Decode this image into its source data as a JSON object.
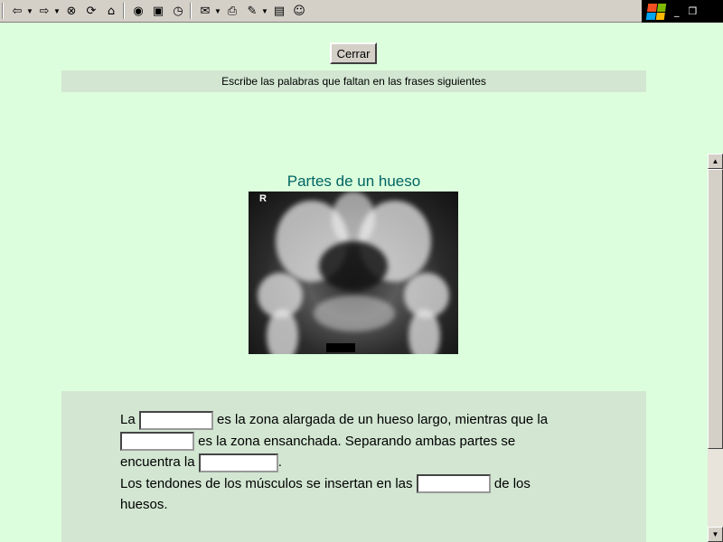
{
  "toolbar": {
    "buttons": [
      {
        "name": "back-button",
        "glyph": "⇦"
      },
      {
        "name": "forward-button",
        "glyph": "⇨"
      },
      {
        "name": "stop-button",
        "glyph": "⊗"
      },
      {
        "name": "refresh-button",
        "glyph": "⟳"
      },
      {
        "name": "home-button",
        "glyph": "⌂"
      },
      {
        "name": "search-button",
        "glyph": "🔍"
      },
      {
        "name": "favorites-button",
        "glyph": "★"
      },
      {
        "name": "history-button",
        "glyph": "◷"
      },
      {
        "name": "mail-button",
        "glyph": "✉"
      },
      {
        "name": "print-button",
        "glyph": "⎙"
      },
      {
        "name": "edit-button",
        "glyph": "✎"
      },
      {
        "name": "discuss-button",
        "glyph": "▤"
      },
      {
        "name": "messenger-button",
        "glyph": "☺"
      }
    ],
    "window_controls": {
      "minimize": "_",
      "restore": "❐"
    }
  },
  "close_label": "Cerrar",
  "instruction": "Escribe las palabras que faltan en las frases siguientes",
  "title": "Partes de un hueso",
  "xray_marker": "R",
  "exercise": {
    "p1_a": "La ",
    "p1_b": " es la zona alargada de un hueso largo, mientras que la ",
    "p1_c": " es la zona ensanchada. Separando ambas partes se encuentra la ",
    "p1_d": ".",
    "p2_a": "Los tendones de los músculos se insertan en las ",
    "p2_b": " de los huesos."
  },
  "colors": {
    "page_bg": "#dcfedc",
    "panel_bg": "#d2e6d2",
    "title": "#006565"
  }
}
